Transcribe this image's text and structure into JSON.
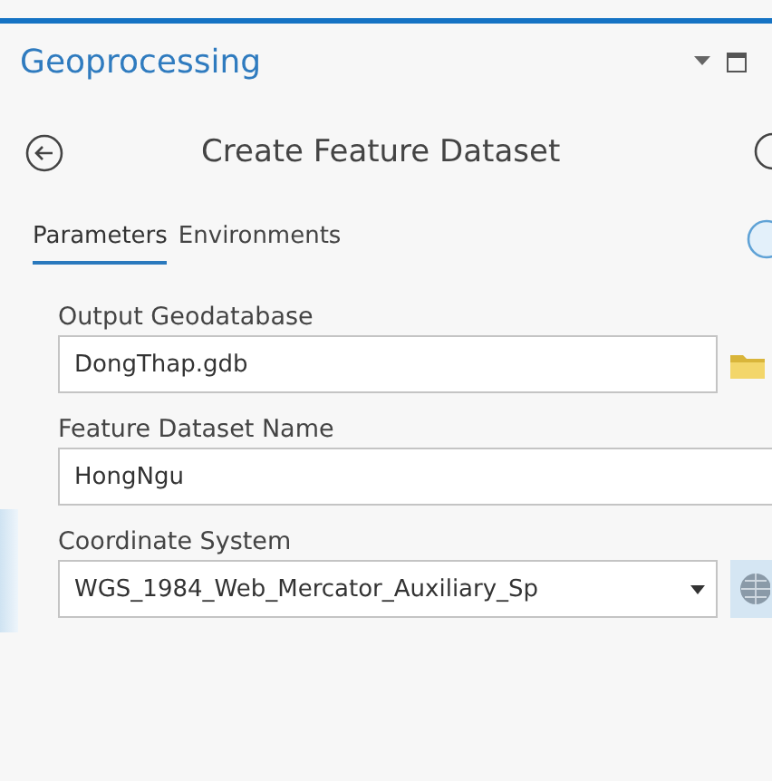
{
  "pane": {
    "title": "Geoprocessing"
  },
  "tool": {
    "title": "Create Feature Dataset"
  },
  "tabs": [
    {
      "label": "Parameters",
      "selected": true
    },
    {
      "label": "Environments",
      "selected": false
    }
  ],
  "parameters": [
    {
      "kind": "folder",
      "label": "Output Geodatabase",
      "value": "DongThap.gdb",
      "highlighted": false
    },
    {
      "kind": "text",
      "label": "Feature Dataset Name",
      "value": "HongNgu",
      "highlighted": false
    },
    {
      "kind": "dropdown",
      "label": "Coordinate System",
      "value": "WGS_1984_Web_Mercator_Auxiliary_Sp",
      "highlighted": true
    }
  ]
}
